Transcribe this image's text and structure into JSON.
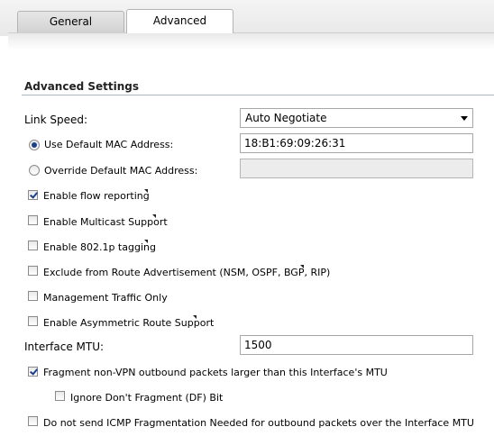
{
  "tabs": [
    {
      "label": "General",
      "active": false
    },
    {
      "label": "Advanced",
      "active": true
    }
  ],
  "section": {
    "title": "Advanced Settings"
  },
  "link_speed": {
    "label": "Link Speed:",
    "value": "Auto Negotiate"
  },
  "mac": {
    "use_default_label": "Use Default MAC Address:",
    "use_default_value": "18:B1:69:09:26:31",
    "override_label": "Override Default MAC Address:",
    "override_value": ""
  },
  "options": {
    "flow_reporting": "Enable flow reporting",
    "multicast": "Enable Multicast Support",
    "tagging": "Enable 802.1p tagging",
    "exclude_route": "Exclude from Route Advertisement (NSM, OSPF, BGP, RIP)",
    "mgmt_only": "Management Traffic Only",
    "asym_route": "Enable Asymmetric Route Support"
  },
  "mtu": {
    "label": "Interface MTU:",
    "value": "1500"
  },
  "fragment": {
    "label": "Fragment non-VPN outbound packets larger than this Interface's MTU",
    "ignore_df": "Ignore Don't Fragment (DF) Bit",
    "no_icmp": "Do not send ICMP Fragmentation Needed for outbound packets over the Interface MTU"
  },
  "state": {
    "use_default_mac": true,
    "flow_reporting": true,
    "multicast": false,
    "tagging": false,
    "exclude_route": false,
    "mgmt_only": false,
    "asym_route": false,
    "fragment": true,
    "ignore_df": false,
    "no_icmp": false
  }
}
